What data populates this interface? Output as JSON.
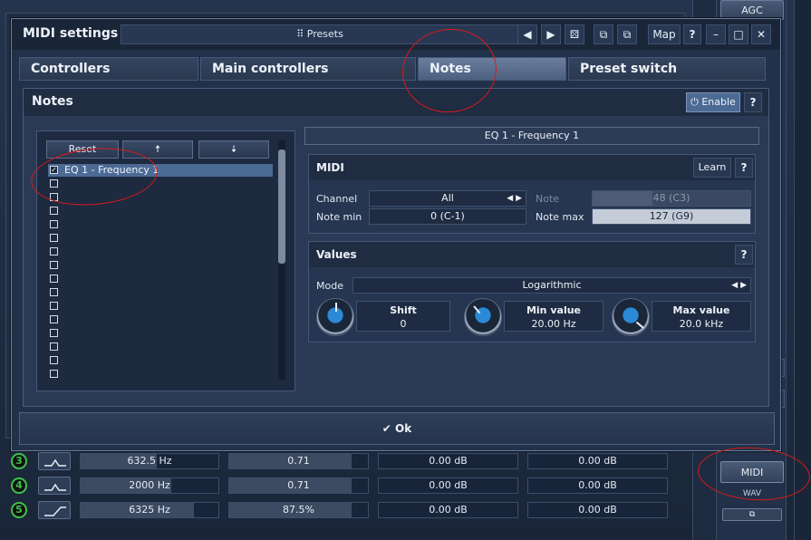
{
  "host": {
    "agc_label": "AGC",
    "midi_label": "MIDI",
    "wav_label": "WAV",
    "bands": [
      {
        "num": "3",
        "freq": "632.5 Hz",
        "q": "0.71",
        "gain1": "0.00 dB",
        "gain2": "0.00 dB",
        "freq_fill": 0.55,
        "q_fill": 0.88
      },
      {
        "num": "4",
        "freq": "2000 Hz",
        "q": "0.71",
        "gain1": "0.00 dB",
        "gain2": "0.00 dB",
        "freq_fill": 0.66,
        "q_fill": 0.88
      },
      {
        "num": "5",
        "freq": "6325 Hz",
        "q": "87.5%",
        "gain1": "0.00 dB",
        "gain2": "0.00 dB",
        "freq_fill": 0.82,
        "q_fill": 0.88
      }
    ]
  },
  "dialog": {
    "title": "MIDI settings",
    "presets_label": "Presets",
    "map_label": "Map",
    "help_label": "?",
    "tabs": [
      {
        "label": "Controllers"
      },
      {
        "label": "Main controllers"
      },
      {
        "label": "Notes"
      },
      {
        "label": "Preset switch"
      }
    ],
    "active_tab": "Notes",
    "ok_label": "Ok"
  },
  "notes": {
    "title": "Notes",
    "enable_label": "Enable",
    "reset_label": "Reset",
    "list": [
      {
        "label": "EQ 1 - Frequency 1",
        "checked": true,
        "selected": true
      },
      {
        "label": "",
        "checked": false
      },
      {
        "label": "",
        "checked": false
      },
      {
        "label": "",
        "checked": false
      },
      {
        "label": "",
        "checked": false
      },
      {
        "label": "",
        "checked": false
      },
      {
        "label": "",
        "checked": false
      },
      {
        "label": "",
        "checked": false
      },
      {
        "label": "",
        "checked": false
      },
      {
        "label": "",
        "checked": false
      },
      {
        "label": "",
        "checked": false
      },
      {
        "label": "",
        "checked": false
      },
      {
        "label": "",
        "checked": false
      },
      {
        "label": "",
        "checked": false
      },
      {
        "label": "",
        "checked": false
      },
      {
        "label": "",
        "checked": false
      }
    ],
    "selected_param": "EQ 1 - Frequency 1",
    "midi": {
      "title": "MIDI",
      "learn_label": "Learn",
      "channel_label": "Channel",
      "channel_value": "All",
      "note_label": "Note",
      "note_value": "48 (C3)",
      "note_min_label": "Note min",
      "note_min_value": "0 (C-1)",
      "note_max_label": "Note max",
      "note_max_value": "127 (G9)"
    },
    "values": {
      "title": "Values",
      "mode_label": "Mode",
      "mode_value": "Logarithmic",
      "shift_label": "Shift",
      "shift_value": "0",
      "min_label": "Min value",
      "min_value": "20.00 Hz",
      "max_label": "Max value",
      "max_value": "20.0 kHz"
    }
  },
  "colors": {
    "annotation": "#d81a1a",
    "accent": "#4b6a94",
    "band_number": "#3cc24a"
  }
}
